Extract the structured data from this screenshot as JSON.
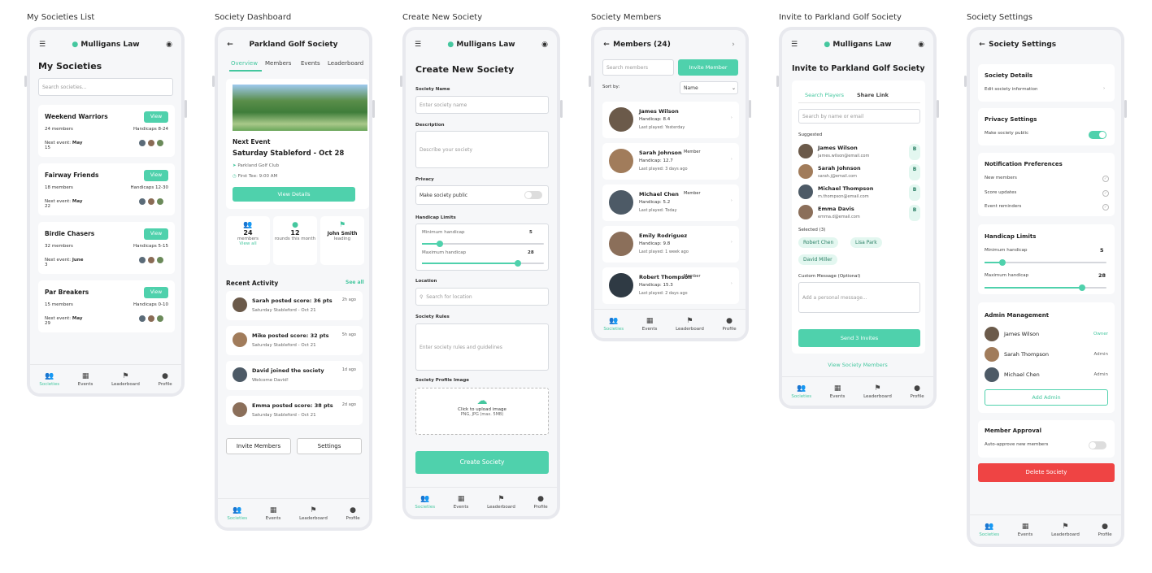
{
  "captions": [
    "My Societies List",
    "Society Dashboard",
    "Create New Society",
    "Society Members",
    "Invite to Parkland Golf Society",
    "Society Settings"
  ],
  "nav": [
    "Societies",
    "Events",
    "Leaderboard",
    "Profile"
  ],
  "brand": "Mulligans Law",
  "s1": {
    "title": "My Societies",
    "search": "Search societies...",
    "view": "View",
    "next_prefix": "Next event:",
    "items": [
      {
        "name": "Weekend Warriors",
        "members": "24 members",
        "handicap": "Handicaps 8-24",
        "next": "May",
        "day": "15"
      },
      {
        "name": "Fairway Friends",
        "members": "18 members",
        "handicap": "Handicaps 12-30",
        "next": "May",
        "day": "22"
      },
      {
        "name": "Birdie Chasers",
        "members": "32 members",
        "handicap": "Handicaps 5-15",
        "next": "June",
        "day": "3"
      },
      {
        "name": "Par Breakers",
        "members": "15 members",
        "handicap": "Handicaps 0-10",
        "next": "May",
        "day": "29"
      }
    ]
  },
  "s2": {
    "title": "Parkland Golf Society",
    "tabs": [
      "Overview",
      "Members",
      "Events",
      "Leaderboard"
    ],
    "next_label": "Next Event",
    "event": "Saturday Stableford - Oct 28",
    "club": "Parkland Golf Club",
    "tee": "First Tee: 9:00 AM",
    "view_details": "View Details",
    "stats": [
      {
        "v": "24",
        "l": "members",
        "x": "View all"
      },
      {
        "v": "12",
        "l": "rounds this month"
      },
      {
        "v": "John Smith",
        "l": "leading"
      }
    ],
    "recent": "Recent Activity",
    "see_all": "See all",
    "acts": [
      {
        "t": "Sarah posted score: 36 pts",
        "s": "Saturday Stableford - Oct 21",
        "a": "2h ago"
      },
      {
        "t": "Mike posted score: 32 pts",
        "s": "Saturday Stableford - Oct 21",
        "a": "5h ago"
      },
      {
        "t": "David joined the society",
        "s": "Welcome David!",
        "a": "1d ago"
      },
      {
        "t": "Emma posted score: 38 pts",
        "s": "Saturday Stableford - Oct 21",
        "a": "2d ago"
      }
    ],
    "invite": "Invite Members",
    "settings": "Settings"
  },
  "s3": {
    "title": "Create New Society",
    "name_l": "Society Name",
    "name_p": "Enter society name",
    "desc_l": "Description",
    "desc_p": "Describe your society",
    "priv_l": "Privacy",
    "priv_t": "Make society public",
    "hc_l": "Handicap Limits",
    "min_l": "Minimum handicap",
    "min_v": "5",
    "max_l": "Maximum handicap",
    "max_v": "28",
    "loc_l": "Location",
    "loc_p": "Search for location",
    "rules_l": "Society Rules",
    "rules_p": "Enter society rules and guidelines",
    "img_l": "Society Profile Image",
    "upload": "Click to upload image",
    "upload_s": "PNG, JPG (max. 5MB)",
    "create": "Create Society"
  },
  "s4": {
    "title": "Members (24)",
    "search": "Search members",
    "invite": "Invite Member",
    "sort_l": "Sort by:",
    "sort_v": "Name",
    "members": [
      {
        "n": "James Wilson",
        "h": "Handicap: 8.4",
        "p": "Last played: Yesterday",
        "tag": ""
      },
      {
        "n": "Sarah Johnson",
        "h": "Handicap: 12.7",
        "p": "Last played: 3 days ago",
        "tag": "Member"
      },
      {
        "n": "Michael Chen",
        "h": "Handicap: 5.2",
        "p": "Last played: Today",
        "tag": "Member"
      },
      {
        "n": "Emily Rodriguez",
        "h": "Handicap: 9.8",
        "p": "Last played: 1 week ago",
        "tag": ""
      },
      {
        "n": "Robert Thompson",
        "h": "Handicap: 15.3",
        "p": "Last played: 2 days ago",
        "tag": "Member"
      }
    ]
  },
  "s5": {
    "title": "Invite to Parkland Golf Society",
    "tab1": "Search Players",
    "tab2": "Share Link",
    "search": "Search by name or email",
    "suggested": "Suggested",
    "people": [
      {
        "n": "James Wilson",
        "e": "james.wilson@email.com"
      },
      {
        "n": "Sarah Johnson",
        "e": "sarah.j@email.com"
      },
      {
        "n": "Michael Thompson",
        "e": "m.thompson@email.com"
      },
      {
        "n": "Emma Davis",
        "e": "emma.d@email.com"
      }
    ],
    "b": "B",
    "selected": "Selected (3)",
    "chips": [
      "Robert Chen",
      "Lisa Park",
      "David Miller"
    ],
    "msg_l": "Custom Message (Optional)",
    "msg_p": "Add a personal message...",
    "send": "Send 3 Invites",
    "view": "View Society Members"
  },
  "s6": {
    "title": "Society Settings",
    "details": "Society Details",
    "edit": "Edit society information",
    "privacy": "Privacy Settings",
    "public": "Make society public",
    "notif": "Notification Preferences",
    "n1": "New members",
    "n2": "Score updates",
    "n3": "Event reminders",
    "hc": "Handicap Limits",
    "min": "Minimum handicap",
    "min_v": "5",
    "max": "Maximum handicap",
    "max_v": "28",
    "admin": "Admin Management",
    "admins": [
      {
        "n": "James Wilson",
        "r": "Owner"
      },
      {
        "n": "Sarah Thompson",
        "r": "Admin"
      },
      {
        "n": "Michael Chen",
        "r": "Admin"
      }
    ],
    "add": "Add Admin",
    "approval": "Member Approval",
    "auto": "Auto-approve new members",
    "delete": "Delete Society"
  },
  "colors": {
    "accent": "#4fd1ac",
    "danger": "#ef4444"
  }
}
